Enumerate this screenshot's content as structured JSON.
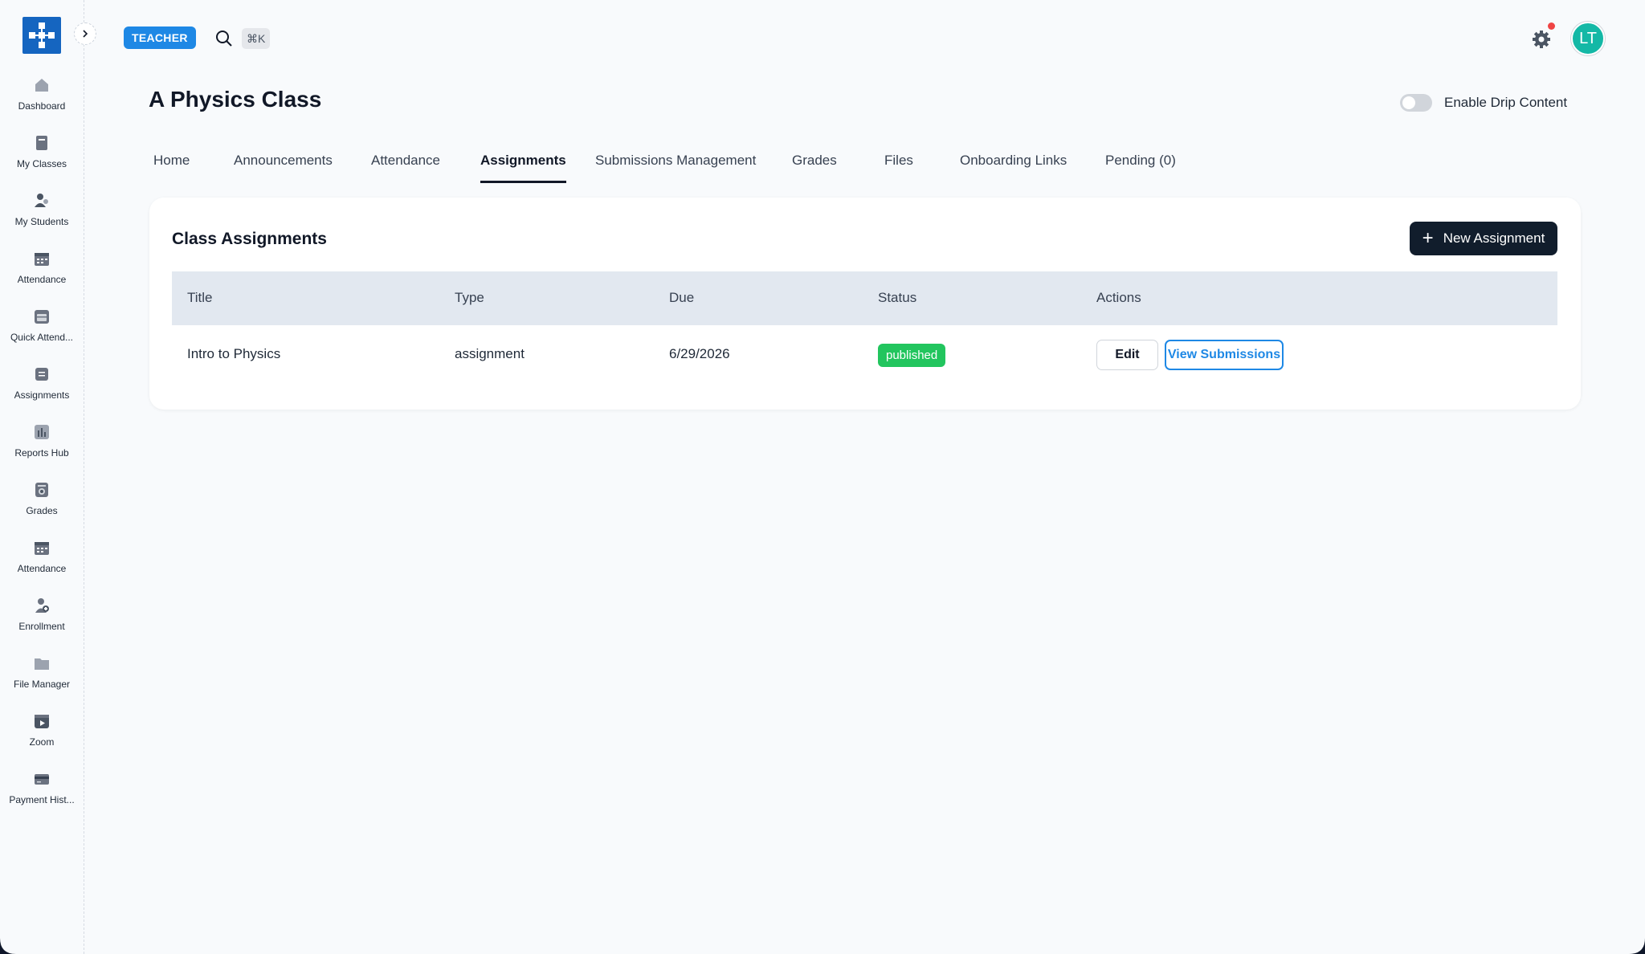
{
  "colors": {
    "brand": "#1565c0",
    "role_badge": "#1e88e5",
    "primary_dark": "#111d2c",
    "published": "#22c55e",
    "avatar": "#14b8a6",
    "notification": "#ef4444"
  },
  "header": {
    "role_badge": "TEACHER",
    "search_shortcut": "⌘K",
    "avatar_initials": "LT"
  },
  "sidebar": {
    "items": [
      {
        "label": "Dashboard",
        "icon": "home-icon"
      },
      {
        "label": "My Classes",
        "icon": "book-icon"
      },
      {
        "label": "My Students",
        "icon": "users-icon"
      },
      {
        "label": "Attendance",
        "icon": "calendar-icon"
      },
      {
        "label": "Quick Attend...",
        "icon": "calendar-check-icon"
      },
      {
        "label": "Assignments",
        "icon": "document-icon"
      },
      {
        "label": "Reports Hub",
        "icon": "bar-chart-icon"
      },
      {
        "label": "Grades",
        "icon": "award-icon"
      },
      {
        "label": "Attendance",
        "icon": "calendar-icon"
      },
      {
        "label": "Enrollment",
        "icon": "user-plus-icon"
      },
      {
        "label": "File Manager",
        "icon": "folder-icon"
      },
      {
        "label": "Zoom",
        "icon": "video-icon"
      },
      {
        "label": "Payment Hist...",
        "icon": "credit-card-icon"
      }
    ]
  },
  "page": {
    "title": "A Physics Class",
    "drip_label": "Enable Drip Content",
    "drip_enabled": false
  },
  "tabs": [
    {
      "label": "Home",
      "active": false
    },
    {
      "label": "Announcements",
      "active": false
    },
    {
      "label": "Attendance",
      "active": false
    },
    {
      "label": "Assignments",
      "active": true
    },
    {
      "label": "Submissions Management",
      "active": false
    },
    {
      "label": "Grades",
      "active": false
    },
    {
      "label": "Files",
      "active": false
    },
    {
      "label": "Onboarding Links",
      "active": false
    },
    {
      "label": "Pending (0)",
      "active": false
    }
  ],
  "assignments": {
    "title": "Class Assignments",
    "new_button": "New Assignment",
    "columns": [
      "Title",
      "Type",
      "Due",
      "Status",
      "Actions"
    ],
    "rows": [
      {
        "title": "Intro to Physics",
        "type": "assignment",
        "due": "6/29/2026",
        "status": "published",
        "edit_label": "Edit",
        "view_label": "View Submissions"
      }
    ]
  }
}
